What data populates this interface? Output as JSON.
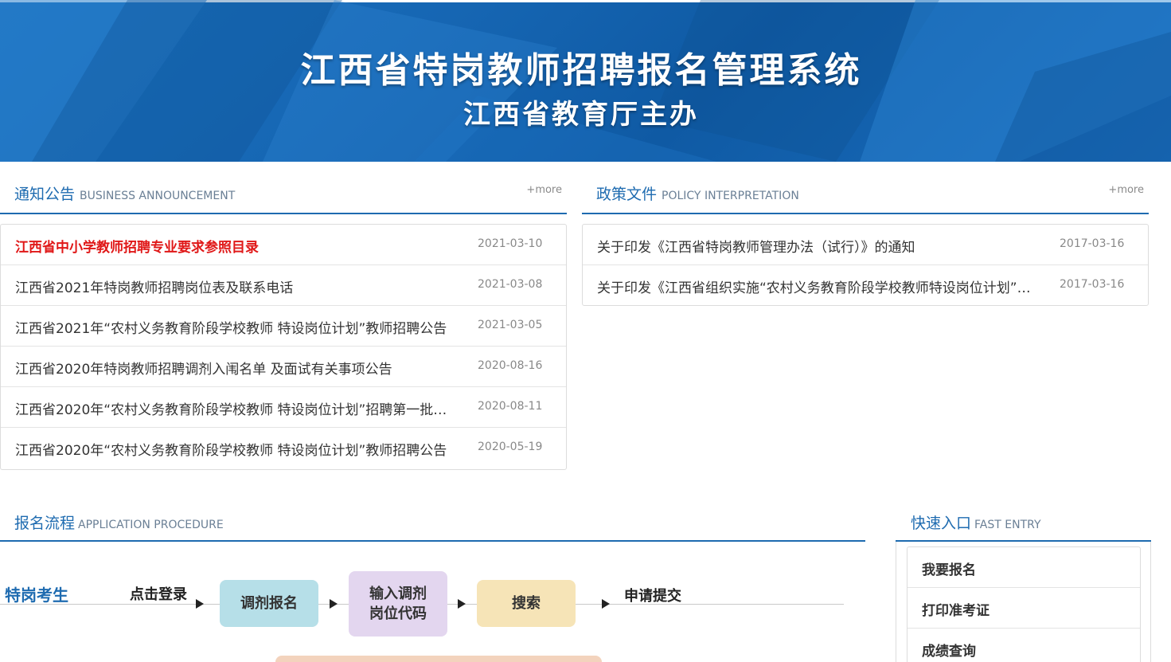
{
  "banner": {
    "title": "江西省特岗教师招聘报名管理系统",
    "subtitle": "江西省教育厅主办"
  },
  "announcement": {
    "title_cn": "通知公告",
    "title_en": "BUSINESS ANNOUNCEMENT",
    "more": "+more",
    "items": [
      {
        "title": "江西省中小学教师招聘专业要求参照目录",
        "date": "2021-03-10"
      },
      {
        "title": "江西省2021年特岗教师招聘岗位表及联系电话",
        "date": "2021-03-08"
      },
      {
        "title": "江西省2021年“农村义务教育阶段学校教师 特设岗位计划”教师招聘公告",
        "date": "2021-03-05"
      },
      {
        "title": "江西省2020年特岗教师招聘调剂入闱名单 及面试有关事项公告",
        "date": "2020-08-16"
      },
      {
        "title": "江西省2020年“农村义务教育阶段学校教师 特设岗位计划”招聘第一批…",
        "date": "2020-08-11"
      },
      {
        "title": "江西省2020年“农村义务教育阶段学校教师 特设岗位计划”教师招聘公告",
        "date": "2020-05-19"
      }
    ]
  },
  "policy": {
    "title_cn": "政策文件",
    "title_en": "POLICY INTERPRETATION",
    "more": "+more",
    "items": [
      {
        "title": "关于印发《江西省特岗教师管理办法（试行）》的通知",
        "date": "2017-03-16"
      },
      {
        "title": "关于印发《江西省组织实施“农村义务教育阶段学校教师特设岗位计划”…",
        "date": "2017-03-16"
      }
    ]
  },
  "procedure": {
    "title_cn": "报名流程",
    "title_en": "APPLICATION PROCEDURE",
    "role": "特岗考生",
    "step_login": "点击登录",
    "step_transfer": "调剂报名",
    "step_code_line1": "输入调剂",
    "step_code_line2": "岗位代码",
    "step_search": "搜索",
    "step_submit": "申请提交"
  },
  "fast_entry": {
    "title_cn": "快速入口",
    "title_en": "FAST ENTRY",
    "items": [
      "我要报名",
      "打印准考证",
      "成绩查询"
    ]
  }
}
